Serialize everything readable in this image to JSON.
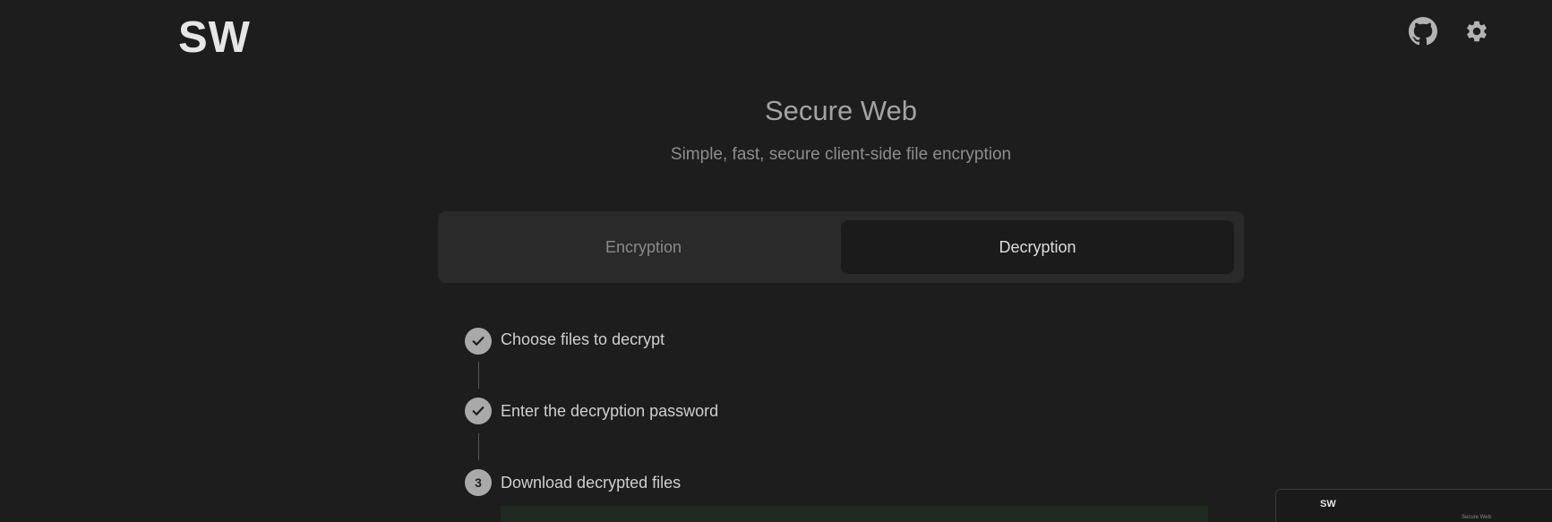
{
  "header": {
    "logo": "SW",
    "icons": {
      "github": "github-icon",
      "settings": "gear-icon"
    }
  },
  "hero": {
    "title": "Secure Web",
    "subtitle": "Simple, fast, secure client-side file encryption"
  },
  "tabs": [
    {
      "label": "Encryption",
      "active": false
    },
    {
      "label": "Decryption",
      "active": true
    }
  ],
  "steps": [
    {
      "index": "1",
      "label": "Choose files to decrypt",
      "completed": true
    },
    {
      "index": "2",
      "label": "Enter the decryption password",
      "completed": true
    },
    {
      "index": "3",
      "label": "Download decrypted files",
      "completed": false
    }
  ],
  "mini_window": {
    "logo": "SW",
    "title": "Secure Web"
  },
  "colors": {
    "background": "#1d1d1d",
    "tabs_background": "#2a2a2a",
    "active_tab": "#1b1b1b",
    "step_circle": "#a9a9a9"
  }
}
